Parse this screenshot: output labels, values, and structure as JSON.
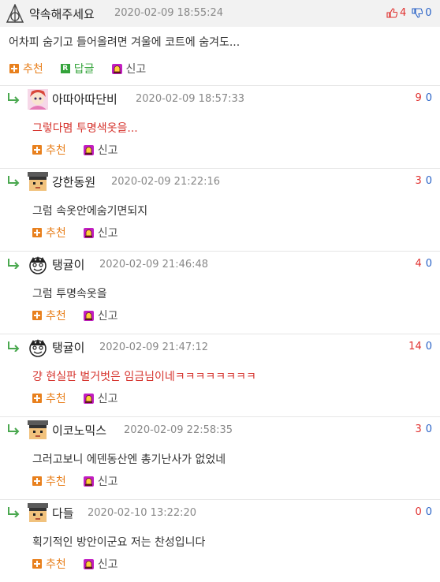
{
  "root": {
    "username": "약속해주세요",
    "date": "2020-02-09 18:55:24",
    "up_votes": "4",
    "down_votes": "0",
    "body": "어차피 숨기고 들어올려면 겨울에 코트에 숨겨도...",
    "actions": {
      "recommend": "추천",
      "reply": "답글",
      "report": "신고"
    }
  },
  "replies": [
    {
      "username": "아따아따단비",
      "date": "2020-02-09 18:57:33",
      "up": "9",
      "down": "0",
      "body": "그렇다몀 투명색옷을...",
      "body_color": "red",
      "avatar": "anime-avatar",
      "recommend": "추천",
      "report": "신고"
    },
    {
      "username": "강한동원",
      "date": "2020-02-09 21:22:16",
      "up": "3",
      "down": "0",
      "body": "그럼 속옷안에숨기면되지",
      "body_color": "dark",
      "avatar": "pixel-avatar",
      "recommend": "추천",
      "report": "신고"
    },
    {
      "username": "탱귤이",
      "date": "2020-02-09 21:46:48",
      "up": "4",
      "down": "0",
      "body": "그럼 투명속옷을",
      "body_color": "dark",
      "avatar": "cartoon-face-avatar",
      "recommend": "추천",
      "report": "신고"
    },
    {
      "username": "탱귤이",
      "date": "2020-02-09 21:47:12",
      "up": "14",
      "down": "0",
      "body": "걍 현실판 벌거벗은 임금님이네ㅋㅋㅋㅋㅋㅋㅋㅋ",
      "body_color": "red",
      "avatar": "cartoon-face-avatar",
      "recommend": "추천",
      "report": "신고"
    },
    {
      "username": "이코노믹스",
      "date": "2020-02-09 22:58:35",
      "up": "3",
      "down": "0",
      "body": "그러고보니 에덴동산엔 총기난사가 없었네",
      "body_color": "dark",
      "avatar": "pixel-avatar",
      "recommend": "추천",
      "report": "신고"
    },
    {
      "username": "다들",
      "date": "2020-02-10 13:22:20",
      "up": "0",
      "down": "0",
      "body": "획기적인 방안이군요 저는 찬성입니다",
      "body_color": "dark",
      "avatar": "pixel-avatar",
      "recommend": "추천",
      "report": "신고"
    }
  ],
  "colors": {
    "header_bg": "#f2f2f2",
    "up": "#e0312f",
    "down": "#2a63c7",
    "accent_orange": "#e8801d",
    "accent_green": "#34a33b",
    "red_text": "#d6342e"
  }
}
